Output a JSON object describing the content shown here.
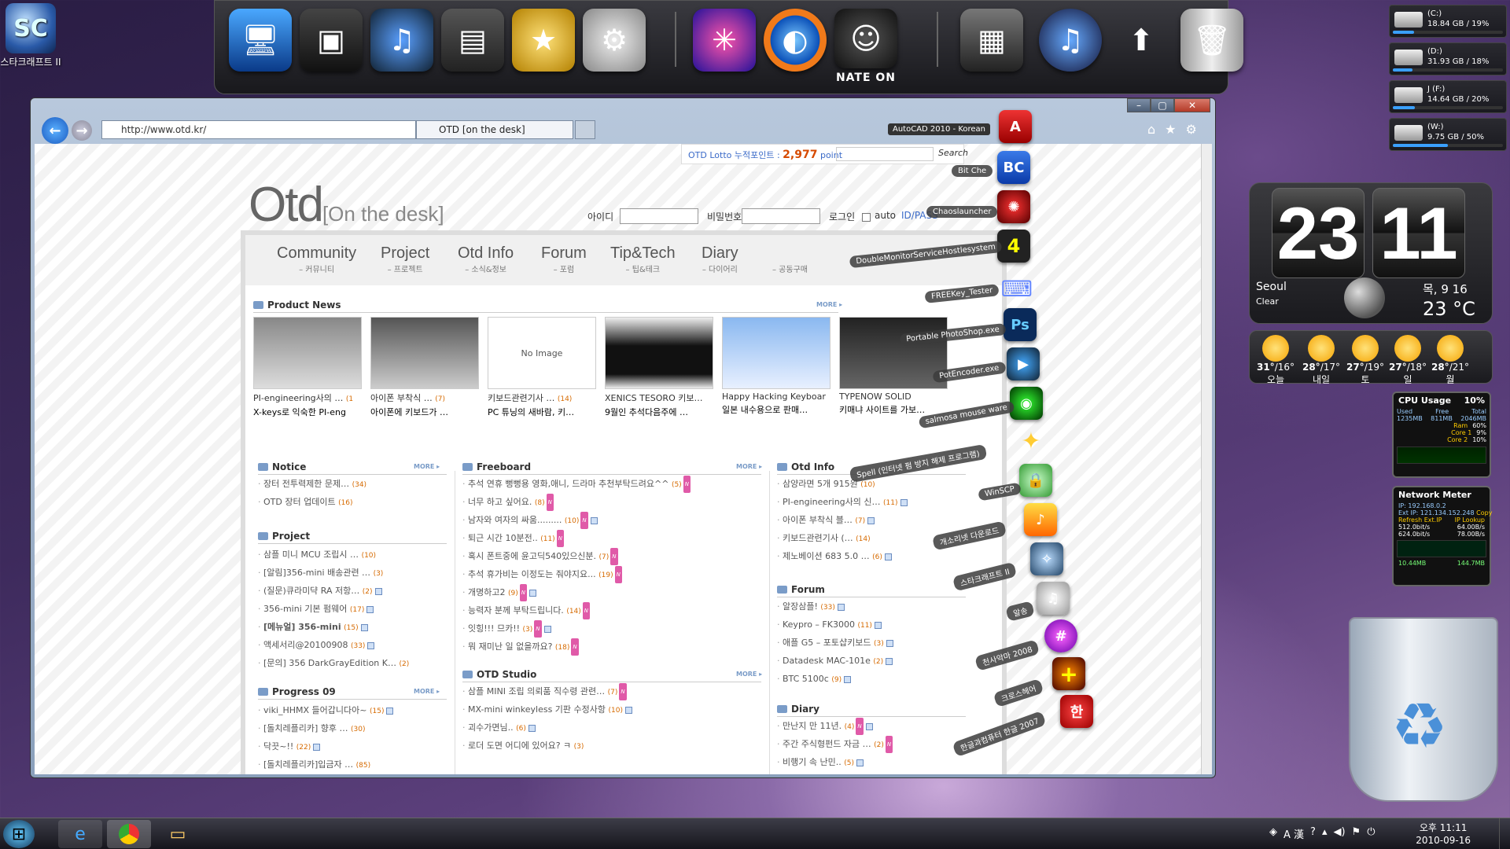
{
  "desktop": {
    "icon_label": "스타크래프트 II",
    "recycle_bin_label": ""
  },
  "dock": {
    "nate_label": "NATE ON"
  },
  "drives": [
    {
      "name": "(C:)",
      "info": "18.84 GB / 19%",
      "used": 0.19
    },
    {
      "name": "(D:)",
      "info": "31.93 GB / 18%",
      "used": 0.18
    },
    {
      "name": "J (F:)",
      "info": "14.64 GB / 20%",
      "used": 0.2
    },
    {
      "name": "(W:)",
      "info": "9.75 GB / 50%",
      "used": 0.5
    }
  ],
  "clock_gadget": {
    "hour": "23",
    "minute": "11",
    "city": "Seoul",
    "cond": "Clear",
    "date": "목, 9 16",
    "temp": "23 °C"
  },
  "forecast": [
    {
      "hi": "31°",
      "lo": "16°",
      "day": "오늘"
    },
    {
      "hi": "28°",
      "lo": "17°",
      "day": "내일"
    },
    {
      "hi": "27°",
      "lo": "19°",
      "day": "토"
    },
    {
      "hi": "27°",
      "lo": "18°",
      "day": "일"
    },
    {
      "hi": "28°",
      "lo": "21°",
      "day": "월"
    }
  ],
  "cpu": {
    "title": "CPU Usage",
    "pct": "10%",
    "used": "1235MB",
    "free": "811MB",
    "total": "2046MB",
    "ram": "60%",
    "core1": "9%",
    "core2": "10%",
    "l_used": "Used",
    "l_free": "Free",
    "l_total": "Total",
    "l_ram": "Ram",
    "l_core1": "Core 1",
    "l_core2": "Core 2"
  },
  "net": {
    "title": "Network Meter",
    "ip": "IP: 192.168.0.2",
    "ext": "Ext IP: 121.134.152.248",
    "copy": "Copy",
    "refresh": "Refresh Ext.IP",
    "lookup": "IP Lookup",
    "up": "512.0bit/s",
    "down": "624.0bit/s",
    "up2": "64.00B/s",
    "down2": "78.00B/s",
    "tot_up": "10.44MB",
    "tot_down": "144.7MB"
  },
  "browser": {
    "url": "http://www.otd.kr/",
    "tab": "OTD [on the desk]",
    "autocad": "AutoCAD 2010 - Korean"
  },
  "page": {
    "lotto_label": "OTD Lotto 누적포인트 :",
    "lotto_value": "2,977",
    "lotto_unit": "point",
    "search_btn": "Search",
    "logo_main": "Otd",
    "logo_sub": "[On the desk]",
    "id_label": "아이디",
    "pw_label": "비밀번호",
    "login_btn": "로그인",
    "auto_label": "auto",
    "idpw_link": "ID/PASS",
    "menu": [
      {
        "en": "Community",
        "ko": "– 커뮤니티"
      },
      {
        "en": "Project",
        "ko": "– 프로젝트"
      },
      {
        "en": "Otd Info",
        "ko": "– 소식&정보"
      },
      {
        "en": "Forum",
        "ko": "– 포럼"
      },
      {
        "en": "Tip&Tech",
        "ko": "– 팁&테크"
      },
      {
        "en": "Diary",
        "ko": "– 다이어리"
      },
      {
        "en": "",
        "ko": "– 공동구매"
      }
    ],
    "more": "MORE ▸",
    "product_news": "Product News",
    "products": [
      {
        "thumb": "",
        "t1": "PI-engineering사의 …",
        "t1c": "(1",
        "t2": "X-keys로 익숙한 PI-eng"
      },
      {
        "thumb": "",
        "t1": "아이폰 부착식 …",
        "t1c": "(7)",
        "t2": "아이폰에 키보드가 …"
      },
      {
        "thumb": "No Image",
        "t1": "키보드관련기사 …",
        "t1c": "(14)",
        "t2": "PC 튜닝의 새바람, 키…"
      },
      {
        "thumb": "",
        "t1": "XENICS TESORO 키보…",
        "t1c": "",
        "t2": "9월인 추석다음주에 …"
      },
      {
        "thumb": "",
        "t1": "Happy Hacking Keyboar",
        "t1c": "",
        "t2": "일본 내수용으로 판매…"
      },
      {
        "thumb": "",
        "t1": "TYPENOW SOLID",
        "t1c": "",
        "t2": "키매냐 사이트를 가보…"
      }
    ],
    "notice": {
      "title": "Notice",
      "items": [
        {
          "t": "장터 전투력제한 문제…",
          "c": "(34)"
        },
        {
          "t": "OTD 장터 업데이트",
          "c": "(16)"
        }
      ]
    },
    "project": {
      "title": "Project",
      "items": [
        {
          "t": "삼플 미니 MCU 조립시 …",
          "c": "(10)"
        },
        {
          "t": "[알림]356-mini 배송관련 …",
          "c": "(3)"
        },
        {
          "t": "(질문)큐라미댝 RA 저항…",
          "c": "(2)"
        },
        {
          "t": "356-mini 기본 펌웨어",
          "c": "(17)"
        },
        {
          "t": "[메뉴얼] 356-mini",
          "c": "(15)"
        },
        {
          "t": "액세서리@20100908",
          "c": "(33)"
        },
        {
          "t": "[문의] 356 DarkGrayEdition K…",
          "c": "(2)"
        }
      ]
    },
    "progress": {
      "title": "Progress 09",
      "items": [
        {
          "t": "viki_HHMX 들어갑니다아~",
          "c": "(15)"
        },
        {
          "t": "[돌치레플리카] 향후 …",
          "c": "(30)"
        },
        {
          "t": "닥끗~!!",
          "c": "(22)"
        },
        {
          "t": "[돌치레플리카]입금자 …",
          "c": "(85)"
        }
      ]
    },
    "freeboard": {
      "title": "Freeboard",
      "items": [
        {
          "t": "추석 연휴 뻥뻥용 영화,애니, 드라마 추천부탁드려요^^",
          "c": "(5)"
        },
        {
          "t": "너무 하고 싶어요.",
          "c": "(8)"
        },
        {
          "t": "남자와 여자의 싸움.........",
          "c": "(10)"
        },
        {
          "t": "퇴근 시간 10분전..",
          "c": "(11)"
        },
        {
          "t": "혹시 폰트중에 윤고딕540있으신분.",
          "c": "(7)"
        },
        {
          "t": "추석 휴가비는 이정도는 줘야지요...",
          "c": "(19)"
        },
        {
          "t": "개명하고2",
          "c": "(9)"
        },
        {
          "t": "능력자 분께 부탁드립니다.",
          "c": "(14)"
        },
        {
          "t": "잇힝!!! 므카!!",
          "c": "(3)"
        },
        {
          "t": "뭐 재미난 일 없을까요?",
          "c": "(18)"
        }
      ]
    },
    "studio": {
      "title": "OTD Studio",
      "items": [
        {
          "t": "삼플 MINI 조립 의뢰품 직수령 관련…",
          "c": "(7)"
        },
        {
          "t": "MX-mini winkeyless 기판 수정사항",
          "c": "(10)"
        },
        {
          "t": "괴수가면님..",
          "c": "(6)"
        },
        {
          "t": "로더 도면 어디에 있어요? ㅋ",
          "c": "(3)"
        }
      ]
    },
    "otdinfo": {
      "title": "Otd Info",
      "items": [
        {
          "t": "삼양라면 5개 915원",
          "c": "(10)"
        },
        {
          "t": "PI-engineering사의 신…",
          "c": "(11)"
        },
        {
          "t": "아이폰 부착식 블…",
          "c": "(7)"
        },
        {
          "t": "키보드관련기사 (…",
          "c": "(14)"
        },
        {
          "t": "제노베이션 683 5.0 …",
          "c": "(6)"
        }
      ]
    },
    "forum": {
      "title": "Forum",
      "items": [
        {
          "t": "알장삼플!",
          "c": "(33)"
        },
        {
          "t": "Keypro – FK3000",
          "c": "(11)"
        },
        {
          "t": "애플 G5 – 포토샵키보드",
          "c": "(3)"
        },
        {
          "t": "Datadesk MAC-101e",
          "c": "(2)"
        },
        {
          "t": "BTC 5100c",
          "c": "(9)"
        }
      ]
    },
    "diary": {
      "title": "Diary",
      "items": [
        {
          "t": "만난지 만 11년.",
          "c": "(4)"
        },
        {
          "t": "주간 주식형펀드 자금 …",
          "c": "(2)"
        },
        {
          "t": "비행기 속 난민..",
          "c": "(5)"
        }
      ]
    }
  },
  "launcher": [
    {
      "label": "Bit Che",
      "glyph": "BC"
    },
    {
      "label": "Chaoslauncher",
      "glyph": "✺"
    },
    {
      "label": "DoubleMonitorServiceHostlesystem",
      "glyph": "4"
    },
    {
      "label": "FREEKey_Tester",
      "glyph": "⌨"
    },
    {
      "label": "Portable PhotoShop.exe",
      "glyph": "Ps"
    },
    {
      "label": "PotEncoder.exe",
      "glyph": "▶"
    },
    {
      "label": "salmosa mouse ware",
      "glyph": "◉"
    },
    {
      "label": "Spell (인터넷 펌 방지 해제 프로그램)",
      "glyph": "✦"
    },
    {
      "label": "WinSCP",
      "glyph": "🔒"
    },
    {
      "label": "개소리넷 다운로드",
      "glyph": "♪"
    },
    {
      "label": "스타크래프트 II",
      "glyph": "✧"
    },
    {
      "label": "알송",
      "glyph": "♫"
    },
    {
      "label": "천사악마 2008",
      "glyph": "#"
    },
    {
      "label": "크로스헤어",
      "glyph": "+"
    },
    {
      "label": "한글과컴퓨터 한글 2007",
      "glyph": "한"
    }
  ],
  "taskbar": {
    "lang": "A 漢",
    "time": "오후 11:11",
    "date": "2010-09-16"
  }
}
